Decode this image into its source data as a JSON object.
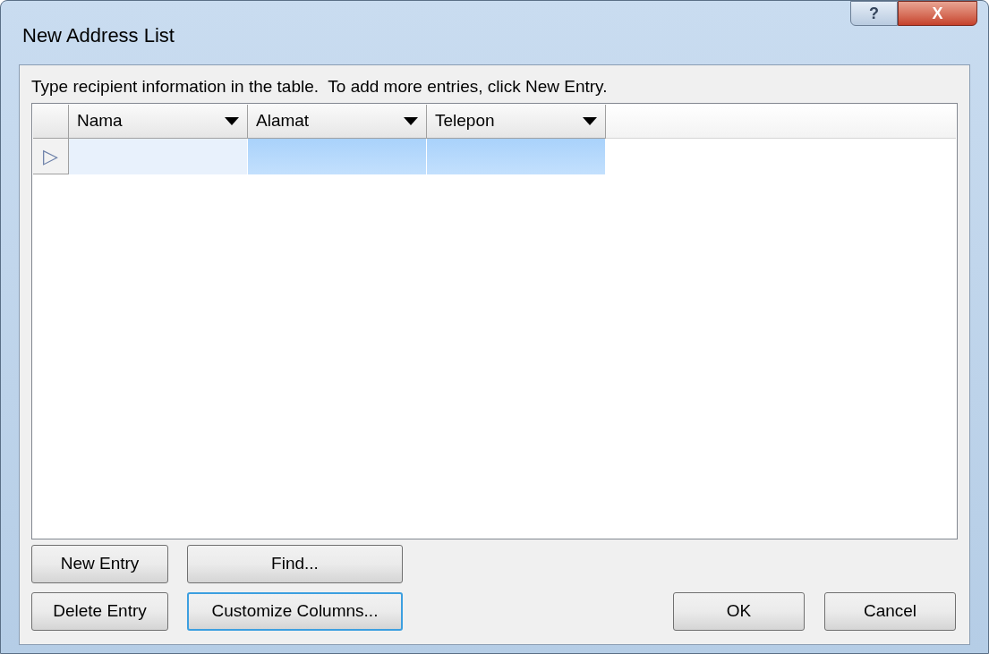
{
  "window": {
    "title": "New Address List"
  },
  "caption_buttons": [
    {
      "kind": "help",
      "glyph": "?"
    },
    {
      "kind": "close",
      "glyph": "X"
    }
  ],
  "instruction": "Type recipient information in the table.  To add more entries, click New Entry.",
  "table": {
    "columns": [
      "Nama",
      "Alamat",
      "Telepon"
    ],
    "rows": [
      {
        "selected": true,
        "marker": "▷",
        "cells": [
          {
            "current": true
          },
          {
            "current": false
          },
          {
            "current": false
          }
        ]
      }
    ]
  },
  "edit_buttons": [
    {
      "label": "New Entry",
      "focused": false
    },
    {
      "label": "Find...",
      "focused": false
    },
    {
      "label": "Delete Entry",
      "focused": false
    },
    {
      "label": "Customize Columns...",
      "focused": true
    }
  ],
  "dialog_buttons": [
    {
      "label": "OK",
      "focused": false
    },
    {
      "label": "Cancel",
      "focused": false
    }
  ]
}
